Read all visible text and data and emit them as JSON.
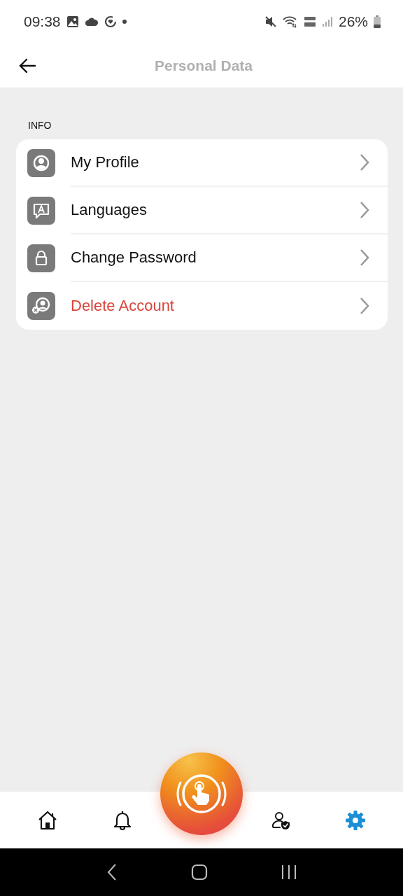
{
  "status_bar": {
    "time": "09:38",
    "battery": "26%"
  },
  "header": {
    "title": "Personal Data"
  },
  "section": {
    "label": "INFO",
    "items": [
      {
        "kind": "profile",
        "label": "My Profile",
        "danger": false
      },
      {
        "kind": "languages",
        "label": "Languages",
        "danger": false
      },
      {
        "kind": "password",
        "label": "Change Password",
        "danger": false
      },
      {
        "kind": "delete",
        "label": "Delete Account",
        "danger": true
      }
    ]
  },
  "bottom_nav": [
    {
      "kind": "home",
      "selected": false
    },
    {
      "kind": "bell",
      "selected": false
    },
    {
      "kind": "fab",
      "selected": false
    },
    {
      "kind": "user",
      "selected": false
    },
    {
      "kind": "gear",
      "selected": true
    }
  ]
}
